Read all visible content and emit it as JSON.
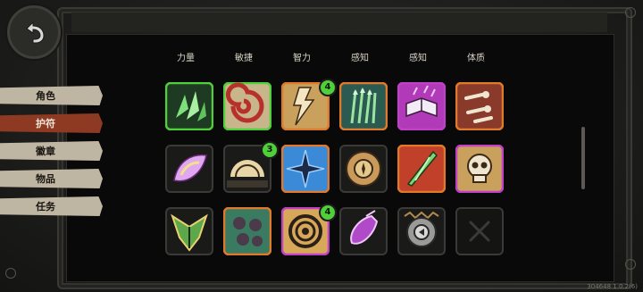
{
  "side_menu": {
    "items": [
      {
        "label": "角色",
        "active": false
      },
      {
        "label": "护符",
        "active": true
      },
      {
        "label": "徽章",
        "active": false
      },
      {
        "label": "物品",
        "active": false
      },
      {
        "label": "任务",
        "active": false
      }
    ]
  },
  "columns": [
    "力量",
    "敏捷",
    "智力",
    "感知",
    "感知",
    "体质"
  ],
  "grid": {
    "rows": [
      [
        {
          "icon": "green-crystal-shards-icon",
          "border": "#4fcf3a",
          "badge": ""
        },
        {
          "icon": "red-swirl-vortex-icon",
          "border": "#4fcf3a",
          "badge": ""
        },
        {
          "icon": "lightning-strike-icon",
          "border": "#e07a2a",
          "badge": "4"
        },
        {
          "icon": "green-arrows-icon",
          "border": "#e07a2a",
          "badge": ""
        },
        {
          "icon": "magic-book-icon",
          "border": "#c040c8",
          "badge": ""
        },
        {
          "icon": "bone-limbs-icon",
          "border": "#e07a2a",
          "badge": ""
        }
      ],
      [
        {
          "icon": "pink-eye-crystal-icon",
          "border": "#3a3a38",
          "badge": ""
        },
        {
          "icon": "sunrise-icon",
          "border": "#3a3a38",
          "badge": "3"
        },
        {
          "icon": "blue-star-shuriken-icon",
          "border": "#e07a2a",
          "badge": ""
        },
        {
          "icon": "golden-compass-icon",
          "border": "#3a3a38",
          "badge": ""
        },
        {
          "icon": "green-blade-icon",
          "border": "#e07a2a",
          "badge": ""
        },
        {
          "icon": "skull-icon",
          "border": "#c040c8",
          "badge": ""
        }
      ],
      [
        {
          "icon": "green-mask-icon",
          "border": "#3a3a38",
          "badge": ""
        },
        {
          "icon": "green-skulls-pattern-icon",
          "border": "#e07a2a",
          "badge": ""
        },
        {
          "icon": "golden-ring-icon",
          "border": "#c040c8",
          "badge": "4"
        },
        {
          "icon": "purple-potion-icon",
          "border": "#3a3a38",
          "badge": ""
        },
        {
          "icon": "silver-medallion-icon",
          "border": "#3a3a38",
          "badge": ""
        },
        {
          "icon": "empty-slot-x-icon",
          "border": "#3a3a38",
          "badge": ""
        }
      ]
    ]
  },
  "version": "304648 1.0.2(6)"
}
